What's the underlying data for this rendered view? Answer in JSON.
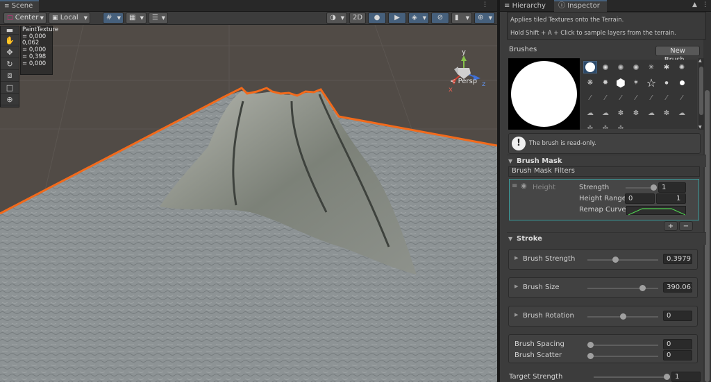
{
  "scene": {
    "tab_label": "Scene",
    "pivot_mode": "Center",
    "pivot_rotation": "Local",
    "btn_2d": "2D",
    "persp_label": "Persp",
    "overlay": {
      "title": "PaintTexture",
      "lines": [
        "= 0,000",
        "0,062",
        "= 0,000",
        "= 0,398",
        "= 0,000"
      ]
    },
    "gizmo_axes": {
      "y": "y",
      "x": "x",
      "z": "z"
    },
    "colors": {
      "selection_outline": "#f26a1b",
      "sky": "#514b46",
      "terrain": "#8f9597"
    }
  },
  "inspector": {
    "tabs": {
      "hierarchy": "Hierarchy",
      "inspector": "Inspector"
    },
    "help_lines": [
      "Applies tiled Textures onto the Terrain.",
      "Hold Shift + A + Click to sample layers from the terrain."
    ],
    "brushes_label": "Brushes",
    "new_brush_button": "New Brush...",
    "readonly_note": "The brush is read-only.",
    "brush_mask": {
      "title": "Brush Mask",
      "filters_label": "Brush Mask Filters",
      "filter_name": "Height",
      "strength_label": "Strength",
      "strength_value": "1",
      "strength_fraction": 1.0,
      "height_range_label": "Height Range",
      "height_min": "0",
      "height_max": "1",
      "remap_label": "Remap Curve",
      "add_button": "+",
      "remove_button": "−"
    },
    "stroke": {
      "title": "Stroke",
      "strength_label": "Brush Strength",
      "strength_value": "0.3979",
      "strength_fraction": 0.3979,
      "size_label": "Brush Size",
      "size_value": "390.062",
      "size_fraction": 0.78,
      "rotation_label": "Brush Rotation",
      "rotation_value": "0",
      "rotation_fraction": 0.5,
      "spacing_label": "Brush Spacing",
      "spacing_value": "0",
      "scatter_label": "Brush Scatter",
      "scatter_value": "0",
      "target_label": "Target Strength",
      "target_value": "1"
    },
    "accent": "#46607c",
    "mask_highlight": "#3a9b9b"
  }
}
